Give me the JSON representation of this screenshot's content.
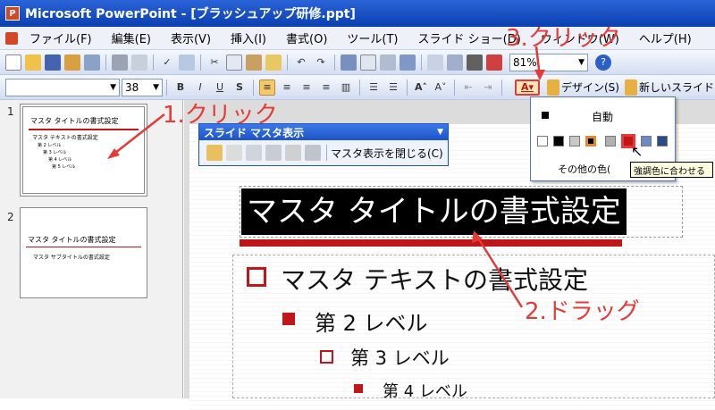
{
  "window": {
    "title": "Microsoft PowerPoint - [ブラッシュアップ研修.ppt]"
  },
  "menu": [
    "ファイル(F)",
    "編集(E)",
    "表示(V)",
    "挿入(I)",
    "書式(O)",
    "ツール(T)",
    "スライド ショー(D)",
    "ウィンドウ(W)",
    "ヘルプ(H)"
  ],
  "toolbar": {
    "zoom": "81%",
    "font_size": "38",
    "design_label": "デザイン(S)",
    "new_slide_label": "新しいスライド"
  },
  "master_toolbar": {
    "title": "スライド マスタ表示",
    "close_label": "マスタ表示を閉じる(C)"
  },
  "thumbnails": [
    {
      "number": "1",
      "title": "マスタ タイトルの書式設定",
      "lines": [
        "マスタ テキストの書式設定",
        "第 2 レベル",
        "第 3 レベル",
        "第 4 レベル",
        "第 5 レベル"
      ]
    },
    {
      "number": "2",
      "title": "マスタ タイトルの書式設定",
      "subtitle": "マスタ サブタイトルの書式設定"
    }
  ],
  "slide": {
    "title": "マスタ タイトルの書式設定",
    "level1": "マスタ テキストの書式設定",
    "level2": "第 2 レベル",
    "level3": "第 3 レベル",
    "level4": "第 4 レベル"
  },
  "color_popup": {
    "auto_label": "自動",
    "other_label": "その他の色(",
    "tooltip": "強調色に合わせる",
    "swatches": [
      "#ffffff",
      "#000000",
      "#c8c8c8",
      "#000000",
      "#b0b0b0",
      "#c0161a",
      "#6d8bc2",
      "#2b4a8c"
    ]
  },
  "annotations": {
    "click1": "1.クリック",
    "drag2": "2.ドラッグ",
    "click3": "3.クリック"
  },
  "colors": {
    "accent_red": "#c0161a",
    "annotation_red": "#e53b38"
  }
}
